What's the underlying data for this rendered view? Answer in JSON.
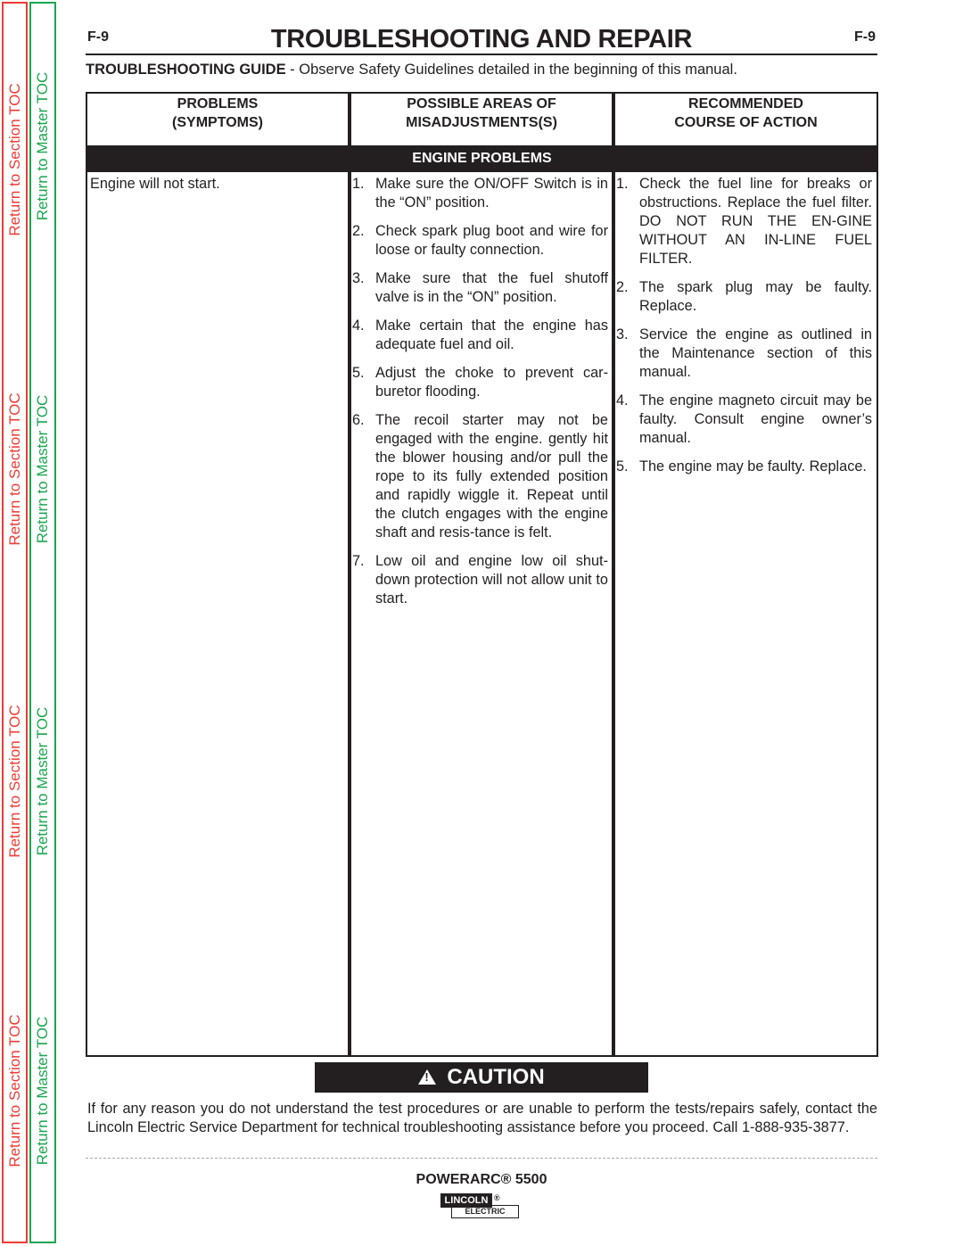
{
  "toc": {
    "section_label": "Return to Section TOC",
    "master_label": "Return to Master TOC",
    "section_color": "#ee3b36",
    "master_color": "#1aa650"
  },
  "header": {
    "page_code_left": "F-9",
    "page_code_right": "F-9",
    "title": "TROUBLESHOOTING AND REPAIR"
  },
  "guide": {
    "bold": "TROUBLESHOOTING GUIDE",
    "text": " - Observe Safety Guidelines detailed in the beginning of this manual."
  },
  "table": {
    "headers": [
      {
        "line1": "PROBLEMS",
        "line2": "(SYMPTOMS)"
      },
      {
        "line1": "POSSIBLE AREAS OF",
        "line2": "MISADJUSTMENTS(S)"
      },
      {
        "line1": "RECOMMENDED",
        "line2": "COURSE OF ACTION"
      }
    ],
    "section_band": "ENGINE  PROBLEMS",
    "symptom": "Engine will not start.",
    "areas": [
      {
        "num": "1.",
        "text": "Make sure the ON/OFF Switch is in the “ON” position."
      },
      {
        "num": "2.",
        "text": "Check spark plug boot and wire for loose or faulty connection."
      },
      {
        "num": "3.",
        "text": "Make sure that the fuel shutoff valve is in the “ON” position."
      },
      {
        "num": "4.",
        "text": "Make certain that the engine has adequate fuel and oil."
      },
      {
        "num": "5.",
        "text": "Adjust the choke to prevent car-buretor flooding."
      },
      {
        "num": "6.",
        "text": "The recoil starter may not be engaged with the engine.  gently hit the blower housing and/or pull the rope to its fully extended position and rapidly wiggle it. Repeat until the clutch engages with the engine shaft and resis-tance is felt."
      },
      {
        "num": "7.",
        "text": "Low oil and engine low oil shut-down protection will not allow unit to start."
      }
    ],
    "actions": [
      {
        "num": "1.",
        "text": "Check the fuel line for breaks or obstructions.  Replace the fuel filter.  DO NOT RUN THE EN-GINE WITHOUT AN IN-LINE FUEL FILTER."
      },
      {
        "num": "2.",
        "text": "The spark plug may be faulty. Replace."
      },
      {
        "num": "3.",
        "text": "Service the engine as outlined in the Maintenance section of this manual."
      },
      {
        "num": "4.",
        "text": "The engine magneto circuit may be faulty.  Consult engine owner’s manual."
      },
      {
        "num": "5.",
        "text": "The engine may be faulty. Replace."
      }
    ]
  },
  "caution": {
    "icon": "warning-triangle-icon",
    "label": "CAUTION",
    "text": "If for any reason you do not understand the test procedures or are unable to perform the tests/repairs safely, contact the Lincoln Electric Service Department for technical troubleshooting assistance before you proceed. Call 1-888-935-3877."
  },
  "footer": {
    "model": "POWERARC® 5500",
    "logo_top": "LINCOLN",
    "logo_bottom": "ELECTRIC",
    "logo_reg": "®"
  }
}
